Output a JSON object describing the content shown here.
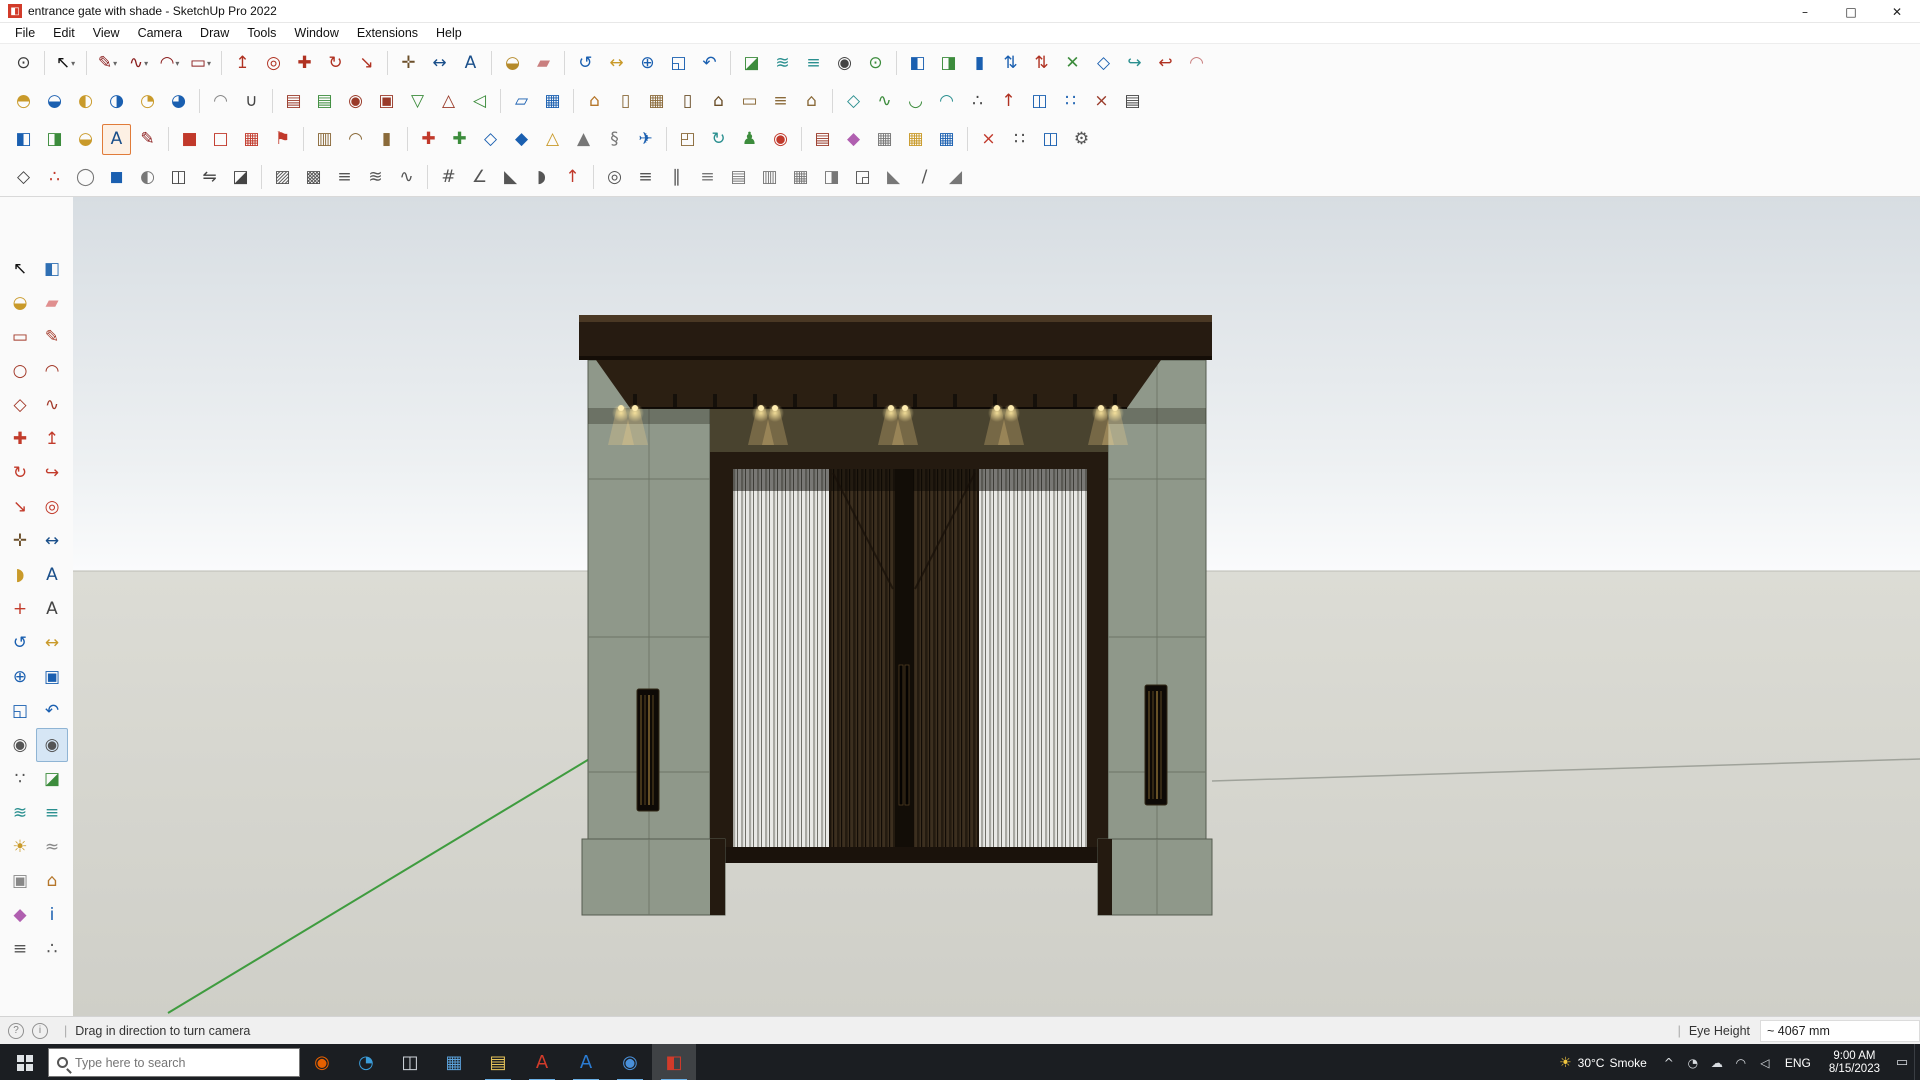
{
  "window": {
    "title": "entrance gate with shade - SketchUp Pro 2022",
    "app_icon_glyph": "◧",
    "controls": [
      {
        "n": "minimize-button",
        "g": "–",
        "c": "#222"
      },
      {
        "n": "maximize-button",
        "g": "□",
        "c": "#222"
      },
      {
        "n": "close-button",
        "g": "✕",
        "c": "#222"
      }
    ]
  },
  "menubar": {
    "items": [
      {
        "n": "menu-file",
        "label": "File"
      },
      {
        "n": "menu-edit",
        "label": "Edit"
      },
      {
        "n": "menu-view",
        "label": "View"
      },
      {
        "n": "menu-camera",
        "label": "Camera"
      },
      {
        "n": "menu-draw",
        "label": "Draw"
      },
      {
        "n": "menu-tools",
        "label": "Tools"
      },
      {
        "n": "menu-window",
        "label": "Window"
      },
      {
        "n": "menu-extensions",
        "label": "Extensions"
      },
      {
        "n": "menu-help",
        "label": "Help"
      }
    ]
  },
  "toolbar": {
    "r1": [
      {
        "n": "zoom-selection-icon",
        "g": "⊙",
        "c": "#3b3b3b"
      },
      {
        "sep": 1
      },
      {
        "n": "select-tool-icon",
        "g": "↖",
        "c": "#111",
        "d": 1
      },
      {
        "sep": 1
      },
      {
        "n": "line-tool-icon",
        "g": "✎",
        "c": "#8a1c1c",
        "d": 1
      },
      {
        "n": "freehand-tool-icon",
        "g": "∿",
        "c": "#8a1c1c",
        "d": 1
      },
      {
        "n": "arc-tool-icon",
        "g": "◠",
        "c": "#8a1c1c",
        "d": 1
      },
      {
        "n": "rectangle-tool-icon",
        "g": "▭",
        "c": "#8a1c1c",
        "d": 1
      },
      {
        "sep": 1
      },
      {
        "n": "pushpull-tool-icon",
        "g": "↥",
        "c": "#b03222"
      },
      {
        "n": "offset-tool-icon",
        "g": "◎",
        "c": "#b03222"
      },
      {
        "n": "move-tool-icon",
        "g": "✚",
        "c": "#b03222"
      },
      {
        "n": "rotate-tool-icon",
        "g": "↻",
        "c": "#b03222"
      },
      {
        "n": "scale-tool-icon",
        "g": "↘",
        "c": "#b03222"
      },
      {
        "sep": 1
      },
      {
        "n": "tape-measure-icon",
        "g": "✛",
        "c": "#6b4f2a"
      },
      {
        "n": "dimension-tool-icon",
        "g": "↔",
        "c": "#1a4f8a"
      },
      {
        "n": "text-tool-icon",
        "g": "A",
        "c": "#1a4f8a"
      },
      {
        "sep": 1
      },
      {
        "n": "paint-bucket-icon",
        "g": "◒",
        "c": "#b58a2a"
      },
      {
        "n": "eraser-tool-icon",
        "g": "▰",
        "c": "#c97f7f"
      },
      {
        "sep": 1
      },
      {
        "n": "orbit-tool-icon",
        "g": "↺",
        "c": "#1a5fb0"
      },
      {
        "n": "pan-tool-icon",
        "g": "↔",
        "c": "#c99a2a"
      },
      {
        "n": "zoom-tool-icon",
        "g": "⊕",
        "c": "#1a5fb0"
      },
      {
        "n": "zoom-extents-icon",
        "g": "◱",
        "c": "#1a5fb0"
      },
      {
        "n": "previous-view-icon",
        "g": "↶",
        "c": "#1a5fb0"
      },
      {
        "sep": 1
      },
      {
        "n": "section-plane-icon",
        "g": "◪",
        "c": "#3c8c3c"
      },
      {
        "n": "section-cuts-icon",
        "g": "≋",
        "c": "#2a8f8f"
      },
      {
        "n": "section-fill-icon",
        "g": "≡",
        "c": "#2a8f8f"
      },
      {
        "n": "position-camera-icon",
        "g": "◉",
        "c": "#444"
      },
      {
        "n": "add-location-icon",
        "g": "⊙",
        "c": "#3c8c3c"
      },
      {
        "sep": 1
      },
      {
        "n": "paint-style-icon",
        "g": "◧",
        "c": "#1a5fb0"
      },
      {
        "n": "split-style-icon",
        "g": "◨",
        "c": "#3c8c3c"
      },
      {
        "n": "column-style-icon",
        "g": "▮",
        "c": "#1a5fb0"
      },
      {
        "n": "sort-ascending-icon",
        "g": "⇅",
        "c": "#1a5fb0"
      },
      {
        "n": "sort-descending-icon",
        "g": "⇅",
        "c": "#b03222"
      },
      {
        "n": "select-connected-icon",
        "g": "✕",
        "c": "#3c8c3c"
      },
      {
        "n": "flip-diamond-icon",
        "g": "◇",
        "c": "#1a5fb0"
      },
      {
        "n": "curl-green-icon",
        "g": "↪",
        "c": "#2a8f8f"
      },
      {
        "n": "curl-red-icon",
        "g": "↩",
        "c": "#b03222"
      },
      {
        "n": "ribbon-tool-icon",
        "g": "◠",
        "c": "#c97f7f"
      }
    ],
    "r2": [
      {
        "n": "outer-shell-icon",
        "g": "◓",
        "c": "#c99a2a"
      },
      {
        "n": "intersect-solid-icon",
        "g": "◒",
        "c": "#1a5fb0"
      },
      {
        "n": "union-solid-icon",
        "g": "◐",
        "c": "#c99a2a"
      },
      {
        "n": "subtract-solid-icon",
        "g": "◑",
        "c": "#1a5fb0"
      },
      {
        "n": "trim-solid-icon",
        "g": "◔",
        "c": "#c99a2a"
      },
      {
        "n": "split-solid-icon",
        "g": "◕",
        "c": "#1a5fb0"
      },
      {
        "sep": 1
      },
      {
        "n": "soften-edges-icon",
        "g": "◠",
        "c": "#888"
      },
      {
        "n": "weld-edges-icon",
        "g": "∪",
        "c": "#444"
      },
      {
        "sep": 1
      },
      {
        "n": "sandbox-contours-icon",
        "g": "▤",
        "c": "#9a3b2a"
      },
      {
        "n": "sandbox-scratch-icon",
        "g": "▤",
        "c": "#3c8c3c"
      },
      {
        "n": "smoove-tool-icon",
        "g": "◉",
        "c": "#9a3b2a"
      },
      {
        "n": "stamp-tool-icon",
        "g": "▣",
        "c": "#9a3b2a"
      },
      {
        "n": "drape-tool-icon",
        "g": "▽",
        "c": "#3c8c3c"
      },
      {
        "n": "add-detail-icon",
        "g": "△",
        "c": "#9a3b2a"
      },
      {
        "n": "flip-edge-icon",
        "g": "◁",
        "c": "#3c8c3c"
      },
      {
        "sep": 1
      },
      {
        "n": "perspective-view-icon",
        "g": "▱",
        "c": "#1a5fb0"
      },
      {
        "n": "grid-tool-icon",
        "g": "▦",
        "c": "#1a5fb0"
      },
      {
        "sep": 1
      },
      {
        "n": "make-component-icon",
        "g": "⌂",
        "c": "#b5762a"
      },
      {
        "n": "wall-tool-icon",
        "g": "▯",
        "c": "#8a6a3a"
      },
      {
        "n": "window-tool-icon",
        "g": "▦",
        "c": "#8a6a3a"
      },
      {
        "n": "door-tool-icon",
        "g": "▯",
        "c": "#6b4f2a"
      },
      {
        "n": "roof-tool-icon",
        "g": "⌂",
        "c": "#6b4f2a"
      },
      {
        "n": "floor-tool-icon",
        "g": "▭",
        "c": "#8a6a3a"
      },
      {
        "n": "stairs-tool-icon",
        "g": "≡",
        "c": "#8a6a3a"
      },
      {
        "n": "building-tool-icon",
        "g": "⌂",
        "c": "#8a6a3a"
      },
      {
        "sep": 1
      },
      {
        "n": "fredo-scale-icon",
        "g": "◇",
        "c": "#2a8f8f"
      },
      {
        "n": "curve-tool-icon",
        "g": "∿",
        "c": "#3c8c3c"
      },
      {
        "n": "bezier-tool-icon",
        "g": "◡",
        "c": "#3c8c3c"
      },
      {
        "n": "round-corner-icon",
        "g": "◠",
        "c": "#2a8f8f"
      },
      {
        "n": "vertex-edit-icon",
        "g": "∴",
        "c": "#444"
      },
      {
        "n": "joint-pushpull-icon",
        "g": "↑",
        "c": "#b03222"
      },
      {
        "n": "mirror-tool-icon",
        "g": "◫",
        "c": "#1a5fb0"
      },
      {
        "n": "array-tool-icon",
        "g": "∷",
        "c": "#1a5fb0"
      },
      {
        "n": "purge-tool-icon",
        "g": "×",
        "c": "#9a3b2a"
      },
      {
        "n": "report-tool-icon",
        "g": "▤",
        "c": "#444"
      }
    ],
    "r3": [
      {
        "n": "layers-panel-icon",
        "g": "◧",
        "c": "#1a5fb0"
      },
      {
        "n": "styles-panel-icon",
        "g": "◨",
        "c": "#3c8c3c"
      },
      {
        "n": "materials-panel-icon",
        "g": "◒",
        "c": "#c99a2a"
      },
      {
        "n": "text-style-editor-icon",
        "g": "A",
        "c": "#1a4f8a",
        "sel": 1
      },
      {
        "n": "sketch-pencil-icon",
        "g": "✎",
        "c": "#8a1c1c"
      },
      {
        "sep": 1
      },
      {
        "n": "material-red-icon",
        "g": "■",
        "c": "#c1392b"
      },
      {
        "n": "frame-red-icon",
        "g": "□",
        "c": "#c1392b"
      },
      {
        "n": "grid-red-icon",
        "g": "▦",
        "c": "#c1392b"
      },
      {
        "n": "flag-tool-icon",
        "g": "⚑",
        "c": "#c1392b"
      },
      {
        "sep": 1
      },
      {
        "n": "crate-box-icon",
        "g": "▥",
        "c": "#8a6a3a"
      },
      {
        "n": "arch-tool-icon",
        "g": "◠",
        "c": "#8a6a3a"
      },
      {
        "n": "column-tool-icon",
        "g": "▮",
        "c": "#8a6a3a"
      },
      {
        "sep": 1
      },
      {
        "n": "pin-red-icon",
        "g": "✚",
        "c": "#c1392b"
      },
      {
        "n": "pin-green-icon",
        "g": "✚",
        "c": "#3c8c3c"
      },
      {
        "n": "crystal-blue-icon",
        "g": "◇",
        "c": "#1a5fb0"
      },
      {
        "n": "drop-blue-icon",
        "g": "◆",
        "c": "#1a5fb0"
      },
      {
        "n": "pyramid-tool-icon",
        "g": "△",
        "c": "#c99a2a"
      },
      {
        "n": "cone-tool-icon",
        "g": "▲",
        "c": "#777"
      },
      {
        "n": "spring-tool-icon",
        "g": "§",
        "c": "#777"
      },
      {
        "n": "airplane-icon",
        "g": "✈",
        "c": "#1a5fb0"
      },
      {
        "sep": 1
      },
      {
        "n": "open-box-icon",
        "g": "◰",
        "c": "#8a6a3a"
      },
      {
        "n": "spin-tool-icon",
        "g": "↻",
        "c": "#2a8f8f"
      },
      {
        "n": "person-figure-icon",
        "g": "♟",
        "c": "#3c8c3c"
      },
      {
        "n": "pushpin-red-icon",
        "g": "◉",
        "c": "#c1392b"
      },
      {
        "sep": 1
      },
      {
        "n": "brick-wall-icon",
        "g": "▤",
        "c": "#9a3b2a"
      },
      {
        "n": "gem-tool-icon",
        "g": "◆",
        "c": "#b05fb0"
      },
      {
        "n": "steel-grid-icon",
        "g": "▦",
        "c": "#777"
      },
      {
        "n": "grid-yellow-icon",
        "g": "▦",
        "c": "#c99a2a"
      },
      {
        "n": "grid-blue-icon",
        "g": "▦",
        "c": "#1a5fb0"
      },
      {
        "sep": 1
      },
      {
        "n": "delete-x-icon",
        "g": "×",
        "c": "#c1392b"
      },
      {
        "n": "dots-array-icon",
        "g": "∷",
        "c": "#444"
      },
      {
        "n": "copy-array-icon",
        "g": "◫",
        "c": "#1a5fb0"
      },
      {
        "n": "settings-gear-icon",
        "g": "⚙",
        "c": "#555"
      }
    ],
    "r4": [
      {
        "n": "prism-tool-icon",
        "g": "◇",
        "c": "#444"
      },
      {
        "n": "vertex-dots-icon",
        "g": "∴",
        "c": "#c1392b"
      },
      {
        "n": "bubble-tool-icon",
        "g": "◯",
        "c": "#777"
      },
      {
        "n": "box-blue-icon",
        "g": "◼",
        "c": "#1a5fb0"
      },
      {
        "n": "shell-half-icon",
        "g": "◐",
        "c": "#777"
      },
      {
        "n": "mirror-plane-icon",
        "g": "◫",
        "c": "#444"
      },
      {
        "n": "flip-horizontal-icon",
        "g": "⇋",
        "c": "#444"
      },
      {
        "n": "section-profile-icon",
        "g": "◪",
        "c": "#444"
      },
      {
        "sep": 1
      },
      {
        "n": "hatch-diagonal-icon",
        "g": "▨",
        "c": "#555"
      },
      {
        "n": "hatch-cross-icon",
        "g": "▩",
        "c": "#555"
      },
      {
        "n": "hatch-lines-icon",
        "g": "≡",
        "c": "#555"
      },
      {
        "n": "zigzag-tool-icon",
        "g": "≋",
        "c": "#555"
      },
      {
        "n": "wave-tool-icon",
        "g": "∿",
        "c": "#555"
      },
      {
        "sep": 1
      },
      {
        "n": "ruler-tool-icon",
        "g": "#",
        "c": "#555"
      },
      {
        "n": "angle-tool-icon",
        "g": "∠",
        "c": "#555"
      },
      {
        "n": "triangle-square-icon",
        "g": "◣",
        "c": "#555"
      },
      {
        "n": "protractor-tool-icon",
        "g": "◗",
        "c": "#555"
      },
      {
        "n": "north-arrow-icon",
        "g": "↑",
        "c": "#c1392b"
      },
      {
        "sep": 1
      },
      {
        "n": "pipe-tool-icon",
        "g": "◎",
        "c": "#555"
      },
      {
        "n": "extrude-lines-icon",
        "g": "≡",
        "c": "#555"
      },
      {
        "n": "rail-tool-icon",
        "g": "∥",
        "c": "#555"
      },
      {
        "n": "stairs-generator-icon",
        "g": "≡",
        "c": "#777"
      },
      {
        "n": "louver-tool-icon",
        "g": "▤",
        "c": "#777"
      },
      {
        "n": "panel-tool-icon",
        "g": "▥",
        "c": "#777"
      },
      {
        "n": "weave-tool-icon",
        "g": "▦",
        "c": "#777"
      },
      {
        "n": "shade-tool-icon",
        "g": "◨",
        "c": "#777"
      },
      {
        "n": "corner-tool-icon",
        "g": "◲",
        "c": "#555"
      },
      {
        "n": "chamfer-tool-icon",
        "g": "◣",
        "c": "#777"
      },
      {
        "n": "slope-tool-icon",
        "g": "/",
        "c": "#555"
      },
      {
        "n": "ramp-tool-icon",
        "g": "◢",
        "c": "#777"
      }
    ]
  },
  "palette": [
    {
      "n": "select-tool",
      "g": "↖",
      "c": "#111"
    },
    {
      "n": "make-component-tool",
      "g": "◧",
      "c": "#2f6fb3"
    },
    {
      "n": "paint-bucket-tool",
      "g": "◒",
      "c": "#c99a2a"
    },
    {
      "n": "eraser-tool",
      "g": "▰",
      "c": "#e08f8f"
    },
    {
      "n": "rectangle-tool",
      "g": "▭",
      "c": "#a33a2a"
    },
    {
      "n": "line-tool",
      "g": "✎",
      "c": "#a33a2a"
    },
    {
      "n": "circle-tool",
      "g": "○",
      "c": "#a33a2a"
    },
    {
      "n": "arc-tool",
      "g": "◠",
      "c": "#a33a2a"
    },
    {
      "n": "polygon-tool",
      "g": "◇",
      "c": "#a33a2a"
    },
    {
      "n": "freehand-tool",
      "g": "∿",
      "c": "#a33a2a"
    },
    {
      "n": "move-tool",
      "g": "✚",
      "c": "#c23b2b"
    },
    {
      "n": "pushpull-tool",
      "g": "↥",
      "c": "#c23b2b"
    },
    {
      "n": "rotate-tool",
      "g": "↻",
      "c": "#c23b2b"
    },
    {
      "n": "followme-tool",
      "g": "↪",
      "c": "#c23b2b"
    },
    {
      "n": "scale-tool",
      "g": "↘",
      "c": "#c23b2b"
    },
    {
      "n": "offset-tool",
      "g": "◎",
      "c": "#c23b2b"
    },
    {
      "n": "tape-measure-tool",
      "g": "✛",
      "c": "#6b4f2a"
    },
    {
      "n": "dimension-tool",
      "g": "↔",
      "c": "#1a4f8a"
    },
    {
      "n": "protractor-tool",
      "g": "◗",
      "c": "#c99a2a"
    },
    {
      "n": "text-tool",
      "g": "A",
      "c": "#1a4f8a"
    },
    {
      "n": "axes-tool",
      "g": "+",
      "c": "#c23b2b"
    },
    {
      "n": "3d-text-tool",
      "g": "A",
      "c": "#444"
    },
    {
      "n": "orbit-tool",
      "g": "↺",
      "c": "#1a5fb0"
    },
    {
      "n": "pan-tool",
      "g": "↔",
      "c": "#c99a2a"
    },
    {
      "n": "zoom-tool",
      "g": "⊕",
      "c": "#1a5fb0"
    },
    {
      "n": "zoom-window-tool",
      "g": "▣",
      "c": "#1a5fb0"
    },
    {
      "n": "zoom-extents-tool",
      "g": "◱",
      "c": "#1a5fb0"
    },
    {
      "n": "previous-view-tool",
      "g": "↶",
      "c": "#1a5fb0"
    },
    {
      "n": "position-camera-tool",
      "g": "◉",
      "c": "#555"
    },
    {
      "n": "look-around-tool",
      "g": "◉",
      "c": "#555",
      "sel": 1
    },
    {
      "n": "walk-tool",
      "g": "∵",
      "c": "#555"
    },
    {
      "n": "section-plane-tool",
      "g": "◪",
      "c": "#3c8c3c"
    },
    {
      "n": "section-display-tool",
      "g": "≋",
      "c": "#2a8f8f"
    },
    {
      "n": "section-outer-tool",
      "g": "≡",
      "c": "#2a8f8f"
    },
    {
      "n": "shadows-tool",
      "g": "☀",
      "c": "#c99a2a"
    },
    {
      "n": "fog-tool",
      "g": "≈",
      "c": "#888"
    },
    {
      "n": "match-photo-tool",
      "g": "▣",
      "c": "#888"
    },
    {
      "n": "3d-warehouse-tool",
      "g": "⌂",
      "c": "#b5762a"
    },
    {
      "n": "extension-warehouse-tool",
      "g": "◆",
      "c": "#b05fb0"
    },
    {
      "n": "model-info-tool",
      "g": "i",
      "c": "#1a5fb0"
    },
    {
      "n": "layers-tool",
      "g": "≡",
      "c": "#555"
    },
    {
      "n": "outliner-tool",
      "g": "∴",
      "c": "#555"
    }
  ],
  "statusbar": {
    "icons": [
      {
        "n": "geolocation-icon",
        "g": "?"
      },
      {
        "n": "credits-info-icon",
        "g": "i"
      }
    ],
    "divider": "|",
    "hint": "Drag in direction to turn camera",
    "eye_height_label": "Eye Height",
    "eye_height_value": "~ 4067 mm"
  },
  "taskbar": {
    "search_placeholder": "Type here to search",
    "apps": [
      {
        "n": "firefox-icon",
        "g": "◉",
        "c": "#e66000"
      },
      {
        "n": "cortana-icon",
        "g": "◔",
        "c": "#3b9cd9"
      },
      {
        "n": "task-view-icon",
        "g": "◫",
        "c": "#cfd4da"
      },
      {
        "n": "calculator-icon",
        "g": "▦",
        "c": "#5aa0d8"
      },
      {
        "n": "file-explorer-icon",
        "g": "▤",
        "c": "#e8c55a",
        "open": 1
      },
      {
        "n": "autocad-icon",
        "g": "A",
        "c": "#d23b2a",
        "open": 1
      },
      {
        "n": "word-icon",
        "g": "A",
        "c": "#2b7cd3",
        "open": 1
      },
      {
        "n": "chrome-icon",
        "g": "◉",
        "c": "#4a90d9",
        "open": 1
      },
      {
        "n": "sketchup-icon",
        "g": "◧",
        "c": "#d23b2a",
        "open": 1,
        "active": 1
      }
    ],
    "weather_icon": "☀",
    "weather_temp": "30°C",
    "weather_cond": "Smoke",
    "tray_icons": [
      {
        "n": "hidden-icons-chevron",
        "g": "^",
        "c": "#d9dde1"
      },
      {
        "n": "tray-app-icon",
        "g": "◔",
        "c": "#d9dde1"
      },
      {
        "n": "onedrive-icon",
        "g": "☁",
        "c": "#d9dde1"
      },
      {
        "n": "network-icon",
        "g": "◠",
        "c": "#d9dde1"
      },
      {
        "n": "volume-icon",
        "g": "◁",
        "c": "#d9dde1"
      }
    ],
    "language": "ENG",
    "time": "9:00 AM",
    "date": "8/15/2023"
  }
}
